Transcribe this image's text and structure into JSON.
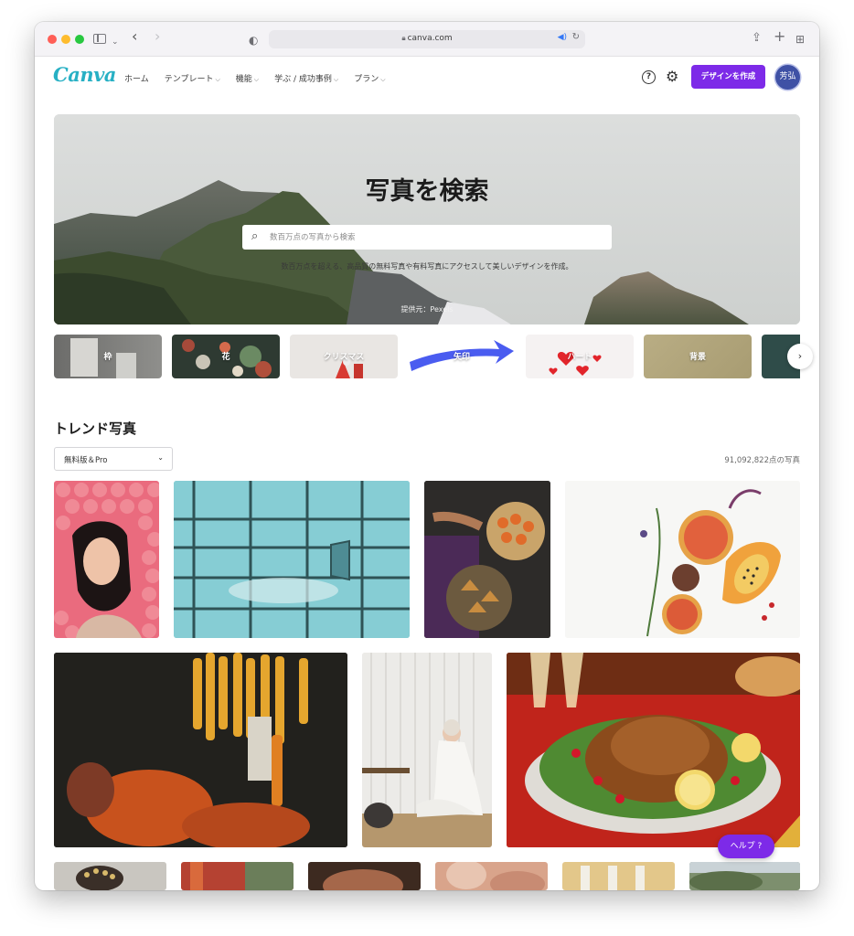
{
  "browser": {
    "url": "canva.com",
    "icons": [
      "sidebar-icon",
      "back-icon",
      "forward-icon",
      "shield-icon",
      "lock-icon",
      "speaker-icon",
      "reload-icon",
      "share-icon",
      "new-tab-icon",
      "tab-overview-icon"
    ]
  },
  "header": {
    "logo": "Canva",
    "nav": [
      {
        "label": "ホーム",
        "has_menu": false
      },
      {
        "label": "テンプレート",
        "has_menu": true
      },
      {
        "label": "機能",
        "has_menu": true
      },
      {
        "label": "学ぶ / 成功事例",
        "has_menu": true
      },
      {
        "label": "プラン",
        "has_menu": true
      }
    ],
    "help_icon": "?",
    "create_button": "デザインを作成",
    "avatar_initials": "芳弘"
  },
  "hero": {
    "title": "写真を検索",
    "search_placeholder": "数百万点の写真から検索",
    "subtitle": "数百万点を超える、高品質の無料写真や有料写真にアクセスして美しいデザインを作成。",
    "credit": "提供元：Pexels"
  },
  "categories": [
    {
      "label": "枠"
    },
    {
      "label": "花"
    },
    {
      "label": "クリスマス"
    },
    {
      "label": "矢印"
    },
    {
      "label": "ハート"
    },
    {
      "label": "背景"
    },
    {
      "label": ""
    }
  ],
  "trending": {
    "title": "トレンド写真",
    "filter_value": "無料版＆Pro",
    "photo_count": "91,092,822点の写真"
  },
  "help_button": "ヘルプ ?",
  "colors": {
    "accent": "#7d2ae8",
    "logo": "#27b0c4"
  }
}
